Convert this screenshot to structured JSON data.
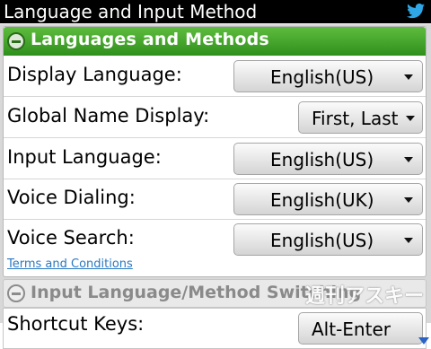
{
  "window": {
    "title": "Language and Input Method",
    "corner_icon": "twitter-bird-icon"
  },
  "sections": {
    "languages": {
      "title": "Languages and Methods",
      "rows": [
        {
          "label": "Display Language:",
          "value": "English(US)"
        },
        {
          "label": "Global Name Display:",
          "value": "First, Last"
        },
        {
          "label": "Input Language:",
          "value": "English(US)"
        },
        {
          "label": "Voice Dialing:",
          "value": "English(UK)"
        },
        {
          "label": "Voice Search:",
          "value": "English(US)"
        }
      ],
      "link": "Terms and Conditions"
    },
    "switching": {
      "title": "Input Language/Method Switching",
      "rows": [
        {
          "label": "Shortcut Keys:",
          "value": "Alt-Enter"
        }
      ]
    }
  },
  "watermark": "週刊アスキー",
  "colors": {
    "section_active": "#3ea52a",
    "link": "#2a78c2",
    "scroll_arrow": "#2a62c8"
  }
}
